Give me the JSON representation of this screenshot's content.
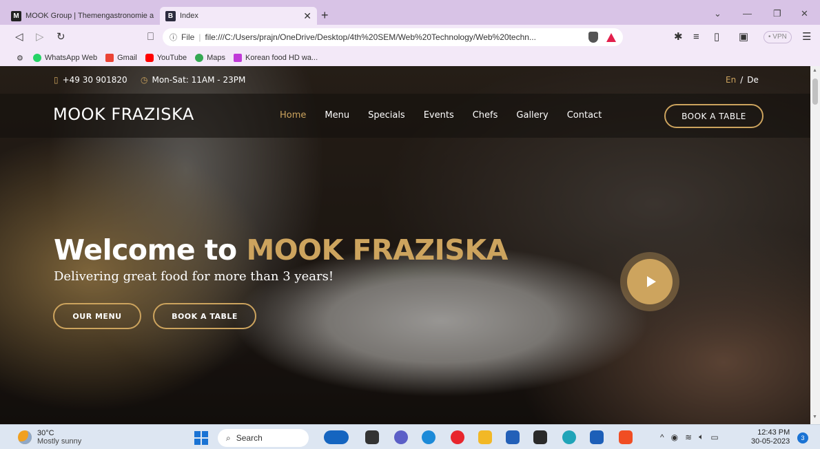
{
  "browser": {
    "tabs": [
      {
        "title": "MOOK Group | Themengastronomie a",
        "favicon": "M"
      },
      {
        "title": "Index",
        "favicon": "B"
      }
    ],
    "new_tab": "+",
    "url_label": "File",
    "url": "file:///C:/Users/prajn/OneDrive/Desktop/4th%20SEM/Web%20Technology/Web%20techn...",
    "vpn": "• VPN",
    "bookmarks": [
      {
        "label": "WhatsApp Web",
        "color": "#25d366"
      },
      {
        "label": "Gmail",
        "color": "#ea4335"
      },
      {
        "label": "YouTube",
        "color": "#ff0000"
      },
      {
        "label": "Maps",
        "color": "#34a853"
      },
      {
        "label": "Korean food HD wa...",
        "color": "#c03ad8"
      }
    ]
  },
  "site": {
    "topbar": {
      "phone": "+49 30 901820",
      "hours": "Mon-Sat: 11AM - 23PM",
      "lang_en": "En",
      "lang_sep": "/",
      "lang_de": "De"
    },
    "logo": "MOOK FRAZISKA",
    "nav": [
      "Home",
      "Menu",
      "Specials",
      "Events",
      "Chefs",
      "Gallery",
      "Contact"
    ],
    "book_button": "BOOK A TABLE",
    "hero": {
      "title_prefix": "Welcome to ",
      "title_brand": "MOOK FRAZISKA",
      "subtitle": "Delivering great food for more than 3 years!",
      "btn_menu": "OUR MENU",
      "btn_book": "BOOK A TABLE"
    },
    "accent_color": "#cda45e"
  },
  "taskbar": {
    "weather_temp": "30°C",
    "weather_cond": "Mostly sunny",
    "search": "Search",
    "time": "12:43 PM",
    "date": "30-05-2023",
    "notifications": "3"
  }
}
